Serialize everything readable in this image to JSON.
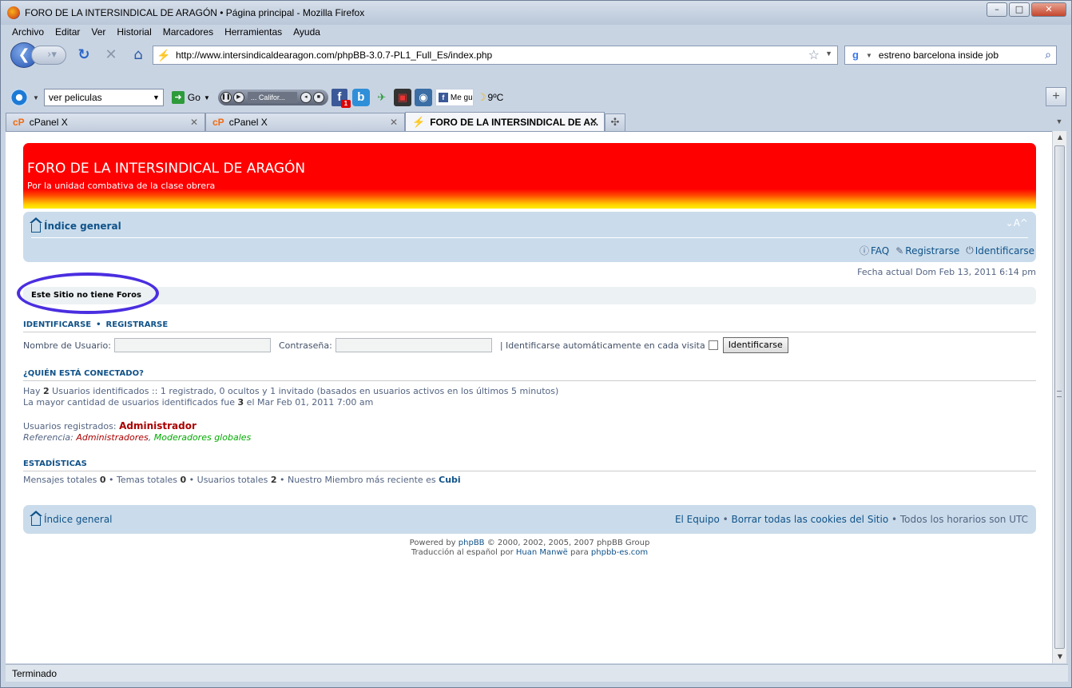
{
  "window": {
    "title": "FORO DE LA INTERSINDICAL DE ARAGÓN • Página principal - Mozilla Firefox",
    "min": "–",
    "max": "□",
    "close": "✕"
  },
  "menu": [
    "Archivo",
    "Editar",
    "Ver",
    "Historial",
    "Marcadores",
    "Herramientas",
    "Ayuda"
  ],
  "nav": {
    "url": "http://www.intersindicaldearagon.com/phpBB-3.0.7-PL1_Full_Es/index.php",
    "search_value": "estreno barcelona inside job"
  },
  "toolbar2": {
    "select_value": "ver peliculas",
    "go_label": "Go",
    "media_text": "...       Califor...",
    "fb_badge": "1",
    "megusta": "Me gu",
    "weather": "9ºC"
  },
  "tabs": [
    {
      "label": "cPanel X",
      "active": false
    },
    {
      "label": "cPanel X",
      "active": false
    },
    {
      "label": "FORO DE LA INTERSINDICAL DE A...",
      "active": true
    }
  ],
  "status": "Terminado",
  "forum": {
    "site_title": "FORO DE LA INTERSINDICAL DE ARAGÓN",
    "site_desc": "Por la unidad combativa de la clase obrera",
    "breadcrumb": "Índice general",
    "fontsize": "⌄A^",
    "links": {
      "faq": "FAQ",
      "register": "Registrarse",
      "login": "Identificarse"
    },
    "date": "Fecha actual Dom Feb 13, 2011 6:14 pm",
    "no_forums": "Este Sitio no tiene Foros",
    "login_section": {
      "identify": "IDENTIFICARSE",
      "register": "REGISTRARSE"
    },
    "login_form": {
      "username_label": "Nombre de Usuario:",
      "password_label": "Contraseña:",
      "auto_label": "| Identificarse automáticamente en cada visita",
      "submit": "Identificarse"
    },
    "who_online": {
      "heading": "¿QUIÉN ESTÁ CONECTADO?",
      "line1_pre": "Hay ",
      "line1_num": "2",
      "line1_post": " Usuarios identificados :: 1 registrado, 0 ocultos y 1 invitado (basados en usuarios activos en los últimos 5 minutos)",
      "line2_pre": "La mayor cantidad de usuarios identificados fue ",
      "line2_num": "3",
      "line2_post": " el Mar Feb 01, 2011 7:00 am",
      "registered_label": "Usuarios registrados: ",
      "registered_user": "Administrador",
      "legend_label": "Referencia: ",
      "legend_admins": "Administradores",
      "legend_sep": ", ",
      "legend_mods": "Moderadores globales"
    },
    "stats": {
      "heading": "ESTADÍSTICAS",
      "posts_label": "Mensajes totales ",
      "posts": "0",
      "topics_label": " • Temas totales ",
      "topics": "0",
      "users_label": " • Usuarios totales ",
      "users": "2",
      "newest_label": " • Nuestro Miembro más reciente es ",
      "newest": "Cubi"
    },
    "footer": {
      "index": "Índice general",
      "team": "El Equipo",
      "sep1": " • ",
      "cookies": "Borrar todas las cookies del Sitio",
      "tz": " • Todos los horarios son UTC"
    },
    "copyright": {
      "l1_pre": "Powered by ",
      "l1_link": "phpBB",
      "l1_post": " © 2000, 2002, 2005, 2007 phpBB Group",
      "l2_pre": "Traducción al español por ",
      "l2_link1": "Huan Manwë",
      "l2_mid": " para ",
      "l2_link2": "phpbb-es.com"
    }
  }
}
